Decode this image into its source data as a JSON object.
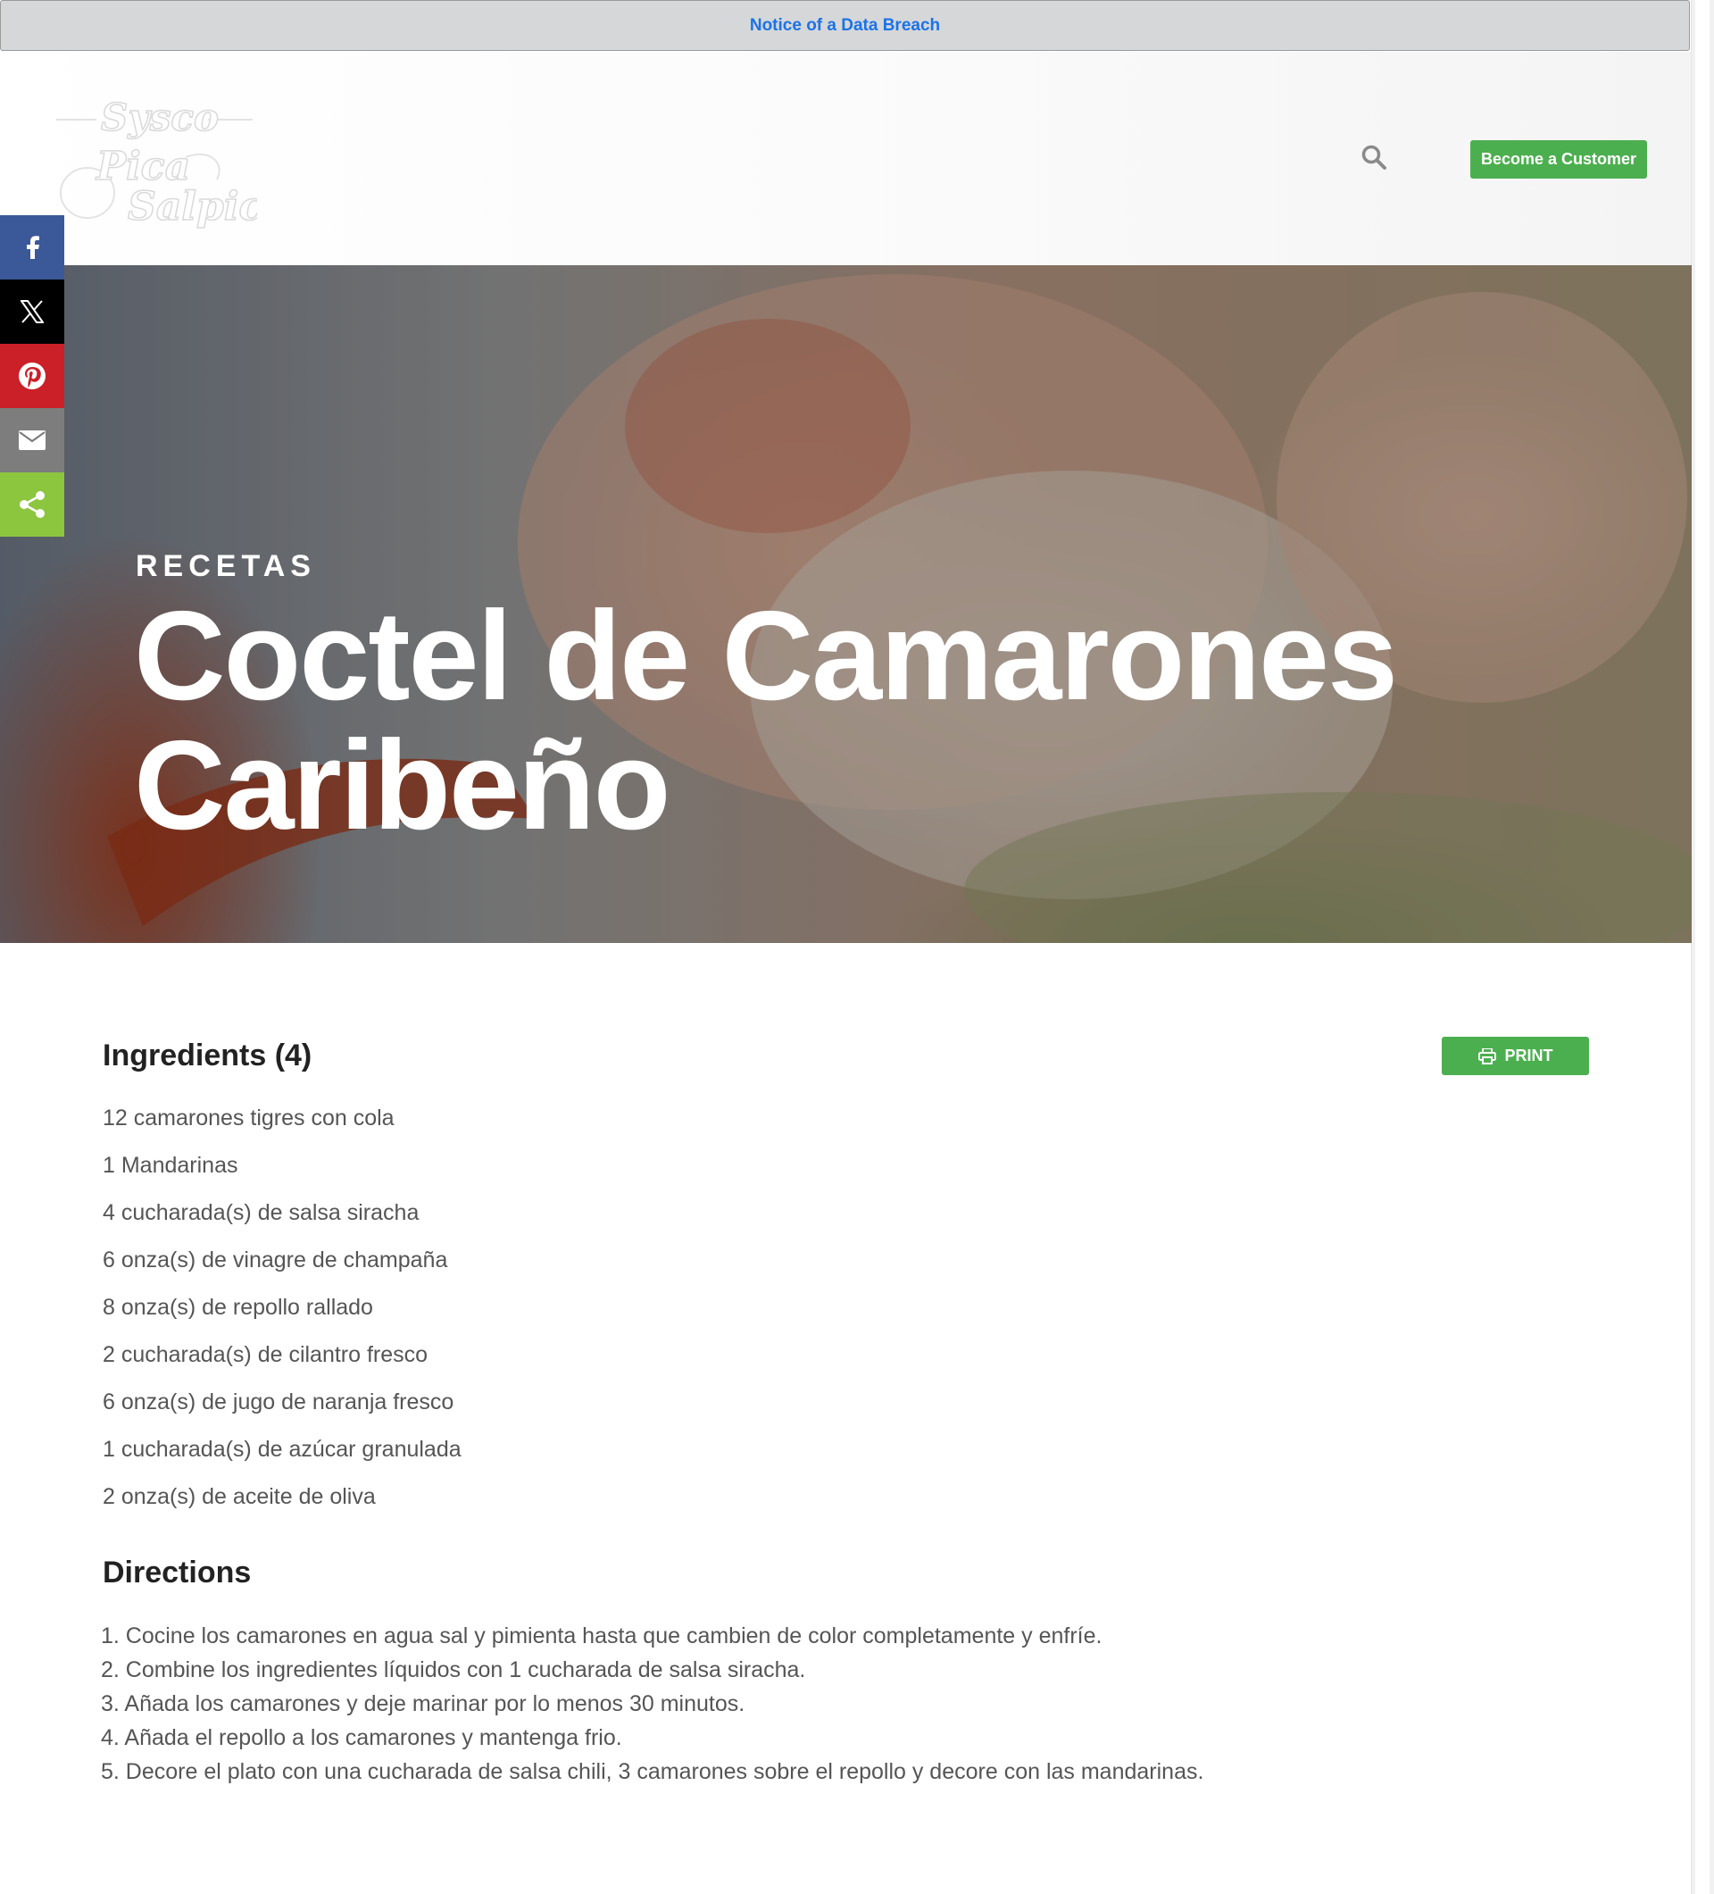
{
  "notice": {
    "text": "Notice of a Data Breach"
  },
  "header": {
    "logo_text_1": "Sysco",
    "logo_text_2": "Pica",
    "logo_text_3": "Salpica",
    "customer_button": "Become a Customer"
  },
  "social": {
    "items": [
      "facebook-icon",
      "x-icon",
      "pinterest-icon",
      "email-icon",
      "share-icon"
    ]
  },
  "hero": {
    "eyebrow": "RECETAS",
    "title_line_1": "Coctel de Camarones",
    "title_line_2": "Caribeño"
  },
  "recipe": {
    "print_label": "PRINT",
    "ingredients_title": "Ingredients (4)",
    "ingredients": [
      "12 camarones tigres con cola",
      "1 Mandarinas",
      "4 cucharada(s) de salsa siracha",
      "6 onza(s) de vinagre de champaña",
      "8 onza(s) de repollo rallado",
      "2 cucharada(s) de cilantro fresco",
      "6 onza(s) de jugo de naranja fresco",
      "1 cucharada(s) de azúcar granulada",
      "2 onza(s) de aceite de oliva"
    ],
    "directions_title": "Directions",
    "directions": [
      "1. Cocine los camarones en agua sal y pimienta hasta que cambien de color completamente y enfríe.",
      "2. Combine los ingredientes líquidos con 1 cucharada de salsa siracha.",
      "3. Añada los camarones y deje marinar por lo menos 30 minutos.",
      "4. Añada el repollo a los camarones y mantenga frio.",
      "5. Decore el plato con una cucharada de salsa chili, 3 camarones sobre el repollo y decore con las mandarinas."
    ]
  },
  "colors": {
    "accent_green": "#4caf4f",
    "link_blue": "#1a73e8",
    "facebook": "#3b5998",
    "pinterest": "#cb2027",
    "share": "#8cc63f"
  }
}
